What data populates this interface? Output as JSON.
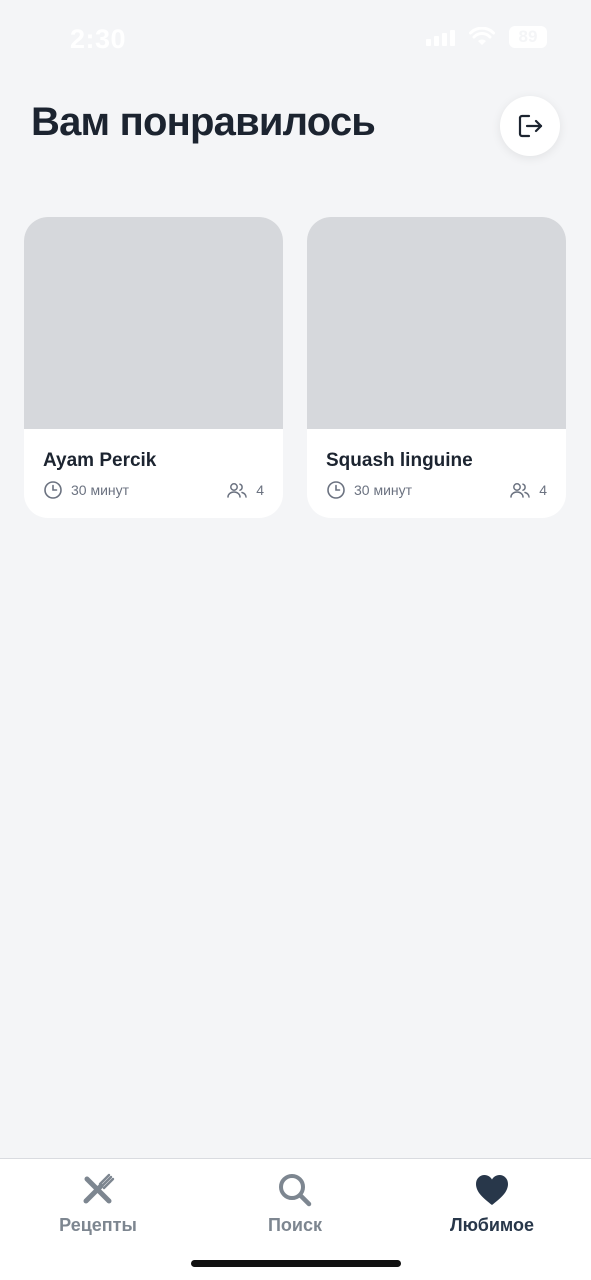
{
  "status_bar": {
    "time": "2:30",
    "battery": "89"
  },
  "header": {
    "title": "Вам понравилось",
    "logout_icon": "logout-icon"
  },
  "cards": [
    {
      "title": "Ayam Percik",
      "time": "30 минут",
      "servings": "4"
    },
    {
      "title": "Squash linguine",
      "time": "30 минут",
      "servings": "4"
    }
  ],
  "tabs": [
    {
      "label": "Рецепты",
      "icon": "fork-knife-icon",
      "active": false
    },
    {
      "label": "Поиск",
      "icon": "search-icon",
      "active": false
    },
    {
      "label": "Любимое",
      "icon": "heart-icon",
      "active": true
    }
  ],
  "colors": {
    "background": "#f4f5f7",
    "card": "#ffffff",
    "image_placeholder": "#d6d8dc",
    "text_primary": "#1c2430",
    "text_secondary": "#6b7280",
    "tab_inactive": "#7d8690",
    "tab_active": "#28374a"
  }
}
